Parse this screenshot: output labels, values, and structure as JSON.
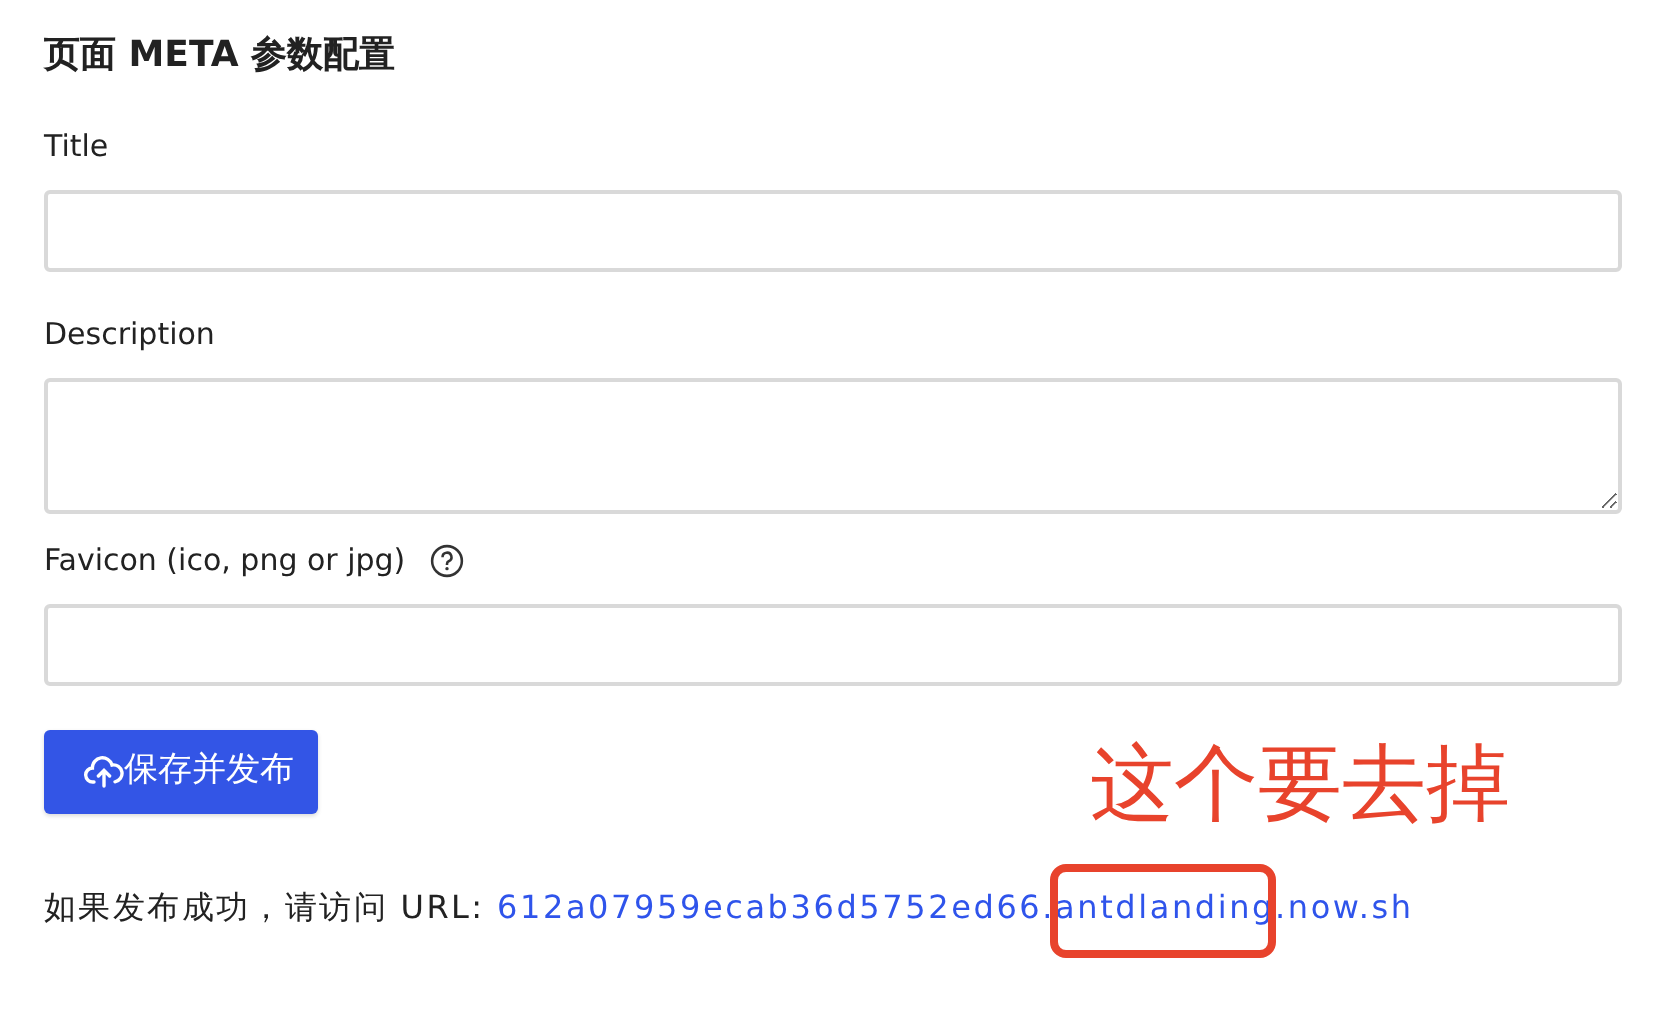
{
  "heading": "页面 META 参数配置",
  "fields": [
    {
      "label": "Title",
      "kind": "input",
      "help": false
    },
    {
      "label": "Description",
      "kind": "textarea",
      "help": false
    },
    {
      "label": "Favicon (ico, png or jpg)",
      "kind": "input",
      "help": true
    }
  ],
  "submit_button": {
    "label": "保存并发布"
  },
  "result": {
    "text": "如果发布成功，请访问 URL:",
    "url_parts": [
      {
        "text": "612a07959ecab36d5752ed66.",
        "marked": false
      },
      {
        "text": "antdlanding",
        "marked": true
      },
      {
        "text": ".now.sh",
        "marked": false
      }
    ]
  },
  "annotation": {
    "text": "这个要去掉"
  }
}
